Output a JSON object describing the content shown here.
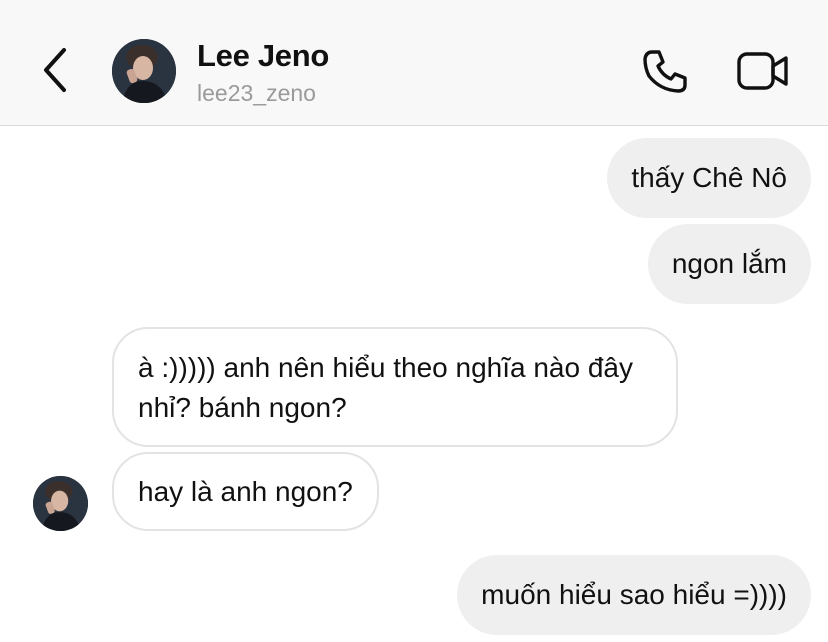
{
  "header": {
    "contact_name": "Lee Jeno",
    "username": "lee23_zeno",
    "back_icon": "chevron-left-icon",
    "call_icon": "phone-icon",
    "video_icon": "video-camera-icon"
  },
  "messages": [
    {
      "direction": "sent",
      "text": "thấy Chê Nô"
    },
    {
      "direction": "sent",
      "text": "ngon lắm"
    },
    {
      "direction": "received",
      "text": "à :))))) anh nên hiểu theo nghĩa nào đây nhỉ? bánh ngon?"
    },
    {
      "direction": "received",
      "text": "hay là anh ngon?"
    },
    {
      "direction": "sent",
      "text": "muốn hiểu sao hiểu =))))"
    }
  ],
  "colors": {
    "header_bg": "#f8f8f8",
    "sent_bubble": "#efefef",
    "received_border": "#e3e3e3",
    "secondary_text": "#9a9a9a"
  }
}
